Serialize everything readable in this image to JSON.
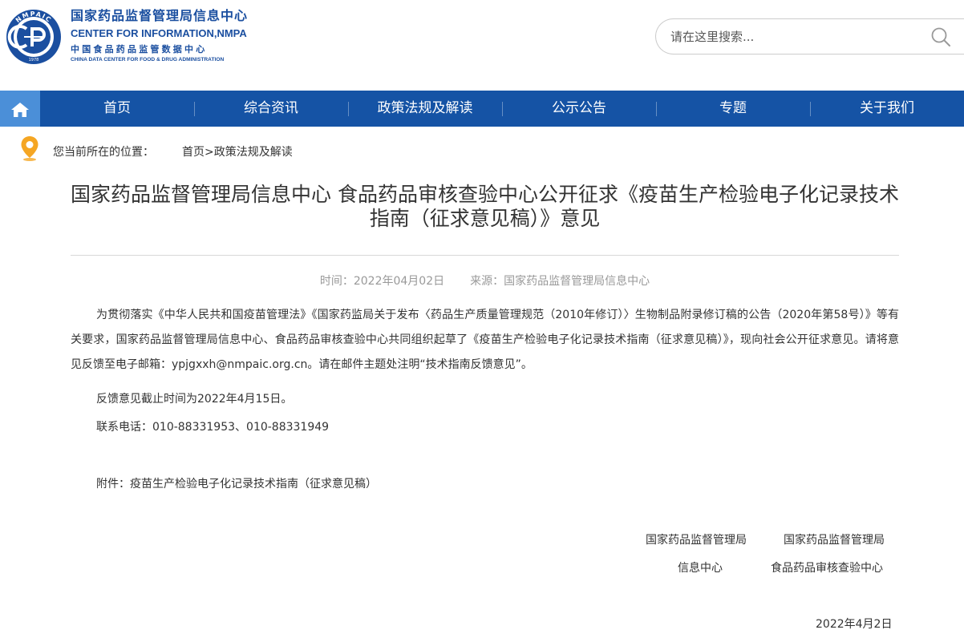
{
  "header": {
    "org_cn": "国家药品监督管理局信息中心",
    "org_en": "CENTER FOR INFORMATION,NMPA",
    "data_center_cn": "中国食品药品监管数据中心",
    "data_center_en": "CHINA DATA CENTER FOR FOOD & DRUG ADMINISTRATION",
    "logo_text": "NMPAIC",
    "logo_year": "1978"
  },
  "search": {
    "placeholder": "请在这里搜索..."
  },
  "nav": {
    "items": [
      {
        "label": "首页"
      },
      {
        "label": "综合资讯"
      },
      {
        "label": "政策法规及解读"
      },
      {
        "label": "公示公告"
      },
      {
        "label": "专题"
      },
      {
        "label": "关于我们"
      }
    ]
  },
  "breadcrumb": {
    "prefix": "您当前所在的位置：",
    "home": "首页",
    "separator": ">",
    "current": "政策法规及解读"
  },
  "article": {
    "title": "国家药品监督管理局信息中心 食品药品审核查验中心公开征求《疫苗生产检验电子化记录技术指南（征求意见稿）》意见",
    "time": "时间：2022年04月02日",
    "source": "来源：国家药品监督管理局信息中心",
    "paragraph1": "为贯彻落实《中华人民共和国疫苗管理法》《国家药监局关于发布〈药品生产质量管理规范（2010年修订）〉生物制品附录修订稿的公告（2020年第58号）》等有关要求，国家药品监督管理局信息中心、食品药品审核查验中心共同组织起草了《疫苗生产检验电子化记录技术指南（征求意见稿）》，现向社会公开征求意见。请将意见反馈至电子邮箱：ypjgxxh@nmpaic.org.cn。请在邮件主题处注明“技术指南反馈意见”。",
    "deadline": "反馈意见截止时间为2022年4月15日。",
    "phone": "联系电话：010-88331953、010-88331949",
    "attachment_prefix": "附件：",
    "attachment_name": "疫苗生产检验电子化记录技术指南（征求意见稿）",
    "signature_left_line1": "国家药品监督管理局",
    "signature_left_line2": "信息中心",
    "signature_right_line1": "国家药品监督管理局",
    "signature_right_line2": "食品药品审核查验中心",
    "date": "2022年4月2日"
  },
  "colors": {
    "brand_blue": "#1b4fa0",
    "nav_bg": "#1553a5",
    "nav_home_bg": "#4b8fd8",
    "pin_orange": "#f5a623",
    "meta_gray": "#999999"
  },
  "icons": [
    "nmpaic-logo",
    "search-icon",
    "home-icon",
    "location-pin-icon"
  ]
}
